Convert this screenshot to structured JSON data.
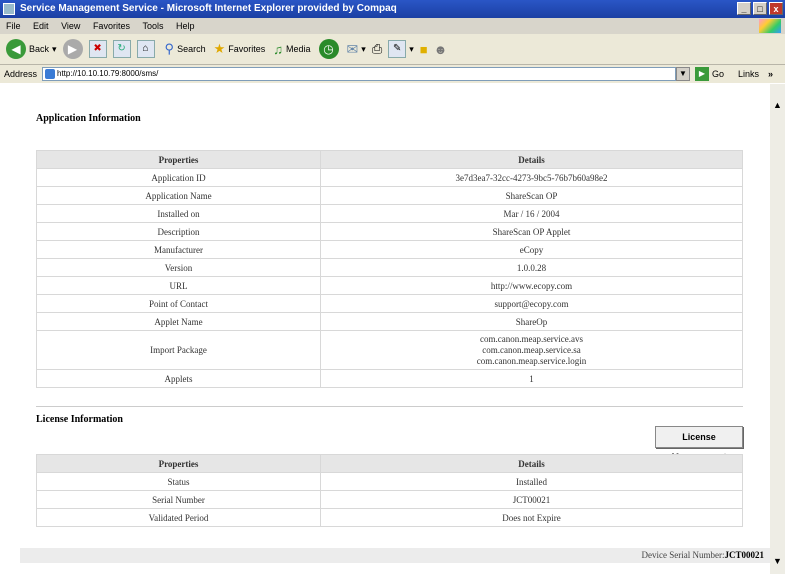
{
  "window": {
    "title": "Service Management Service - Microsoft Internet Explorer provided by Compaq",
    "controls": [
      "_",
      "□",
      "x"
    ]
  },
  "menu": [
    "File",
    "Edit",
    "View",
    "Favorites",
    "Tools",
    "Help"
  ],
  "toolbar": {
    "back": "Back",
    "search": "Search",
    "favorites": "Favorites",
    "media": "Media"
  },
  "address": {
    "label": "Address",
    "url": "http://10.10.10.79:8000/sms/",
    "go": "Go",
    "links": "Links",
    "more": "»"
  },
  "app_info": {
    "title": "Application Information",
    "headers": [
      "Properties",
      "Details"
    ],
    "rows": [
      {
        "prop": "Application ID",
        "detail": "3e7d3ea7-32cc-4273-9bc5-76b7b60a98e2"
      },
      {
        "prop": "Application Name",
        "detail": "ShareScan OP"
      },
      {
        "prop": "Installed on",
        "detail": "Mar / 16 / 2004"
      },
      {
        "prop": "Description",
        "detail": "ShareScan OP Applet"
      },
      {
        "prop": "Manufacturer",
        "detail": "eCopy"
      },
      {
        "prop": "Version",
        "detail": "1.0.0.28"
      },
      {
        "prop": "URL",
        "detail": "http://www.ecopy.com"
      },
      {
        "prop": "Point of Contact",
        "detail": "support@ecopy.com"
      },
      {
        "prop": "Applet Name",
        "detail": "ShareOp"
      },
      {
        "prop": "Import Package",
        "detail": "com.canon.meap.service.avs\ncom.canon.meap.service.sa\ncom.canon.meap.service.login"
      },
      {
        "prop": "Applets",
        "detail": "1"
      }
    ]
  },
  "license_info": {
    "title": "License Information",
    "button": "License Management",
    "headers": [
      "Properties",
      "Details"
    ],
    "rows": [
      {
        "prop": "Status",
        "detail": "Installed"
      },
      {
        "prop": "Serial Number",
        "detail": "JCT00021"
      },
      {
        "prop": "Validated Period",
        "detail": "Does not Expire"
      }
    ]
  },
  "footer": {
    "label": "Device Serial Number:",
    "value": "JCT00021"
  }
}
